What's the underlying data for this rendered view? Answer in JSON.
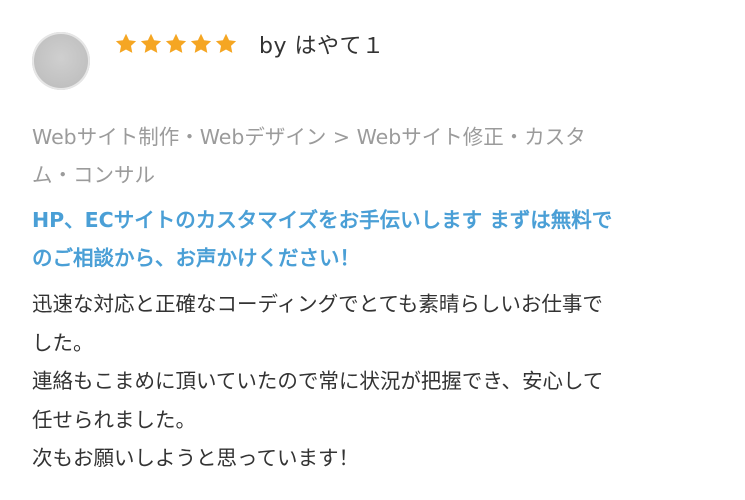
{
  "review": {
    "rating": 5,
    "reviewer_text": "by はやて１",
    "category_lines": [
      "Webサイト制作・Webデザイン > Webサイト修正・カスタ",
      "ム・コンサル"
    ],
    "service_title_lines": [
      "HP、ECサイトのカスタマイズをお手伝いします まずは無料で",
      "のご相談から、お声かけください！"
    ],
    "body_lines": [
      "迅速な対応と正確なコーディングでとても素晴らしいお仕事で",
      "した。",
      "連絡もこまめに頂いていたので常に状況が把握でき、安心して",
      "任せられました。",
      "次もお願いしようと思っています！"
    ]
  },
  "colors": {
    "star": "#f5a623",
    "link": "#4a9fd6",
    "muted": "#9b9b9b",
    "text": "#333333"
  },
  "icons": {
    "star": "star-icon",
    "avatar": "avatar"
  }
}
